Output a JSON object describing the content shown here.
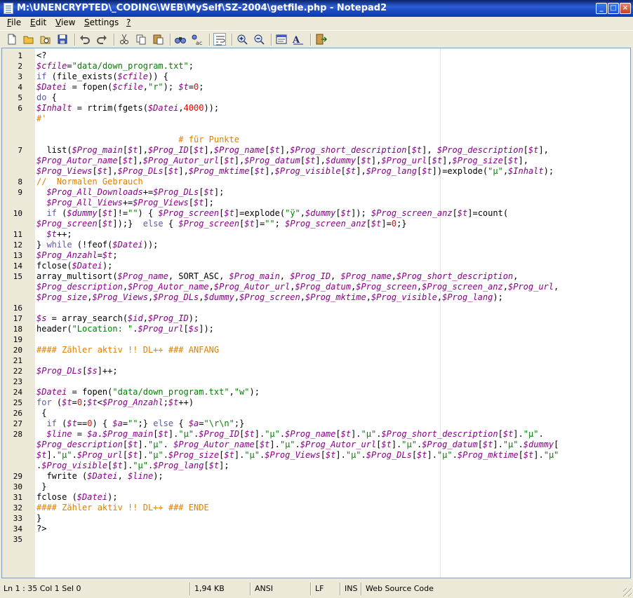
{
  "window": {
    "title": "M:\\UNENCRYPTED\\_CODING\\WEB\\MySelf\\SZ-2004\\getfile.php - Notepad2",
    "controls": [
      "minimize-icon",
      "maximize-icon",
      "close-icon"
    ]
  },
  "menu": [
    {
      "label": "File",
      "ul": "F",
      "rest": "ile"
    },
    {
      "label": "Edit",
      "ul": "E",
      "rest": "dit"
    },
    {
      "label": "View",
      "ul": "V",
      "rest": "iew"
    },
    {
      "label": "Settings",
      "ul": "S",
      "rest": "ettings"
    },
    {
      "label": "?",
      "ul": "?",
      "rest": ""
    }
  ],
  "toolbar": [
    "new-icon",
    "open-icon",
    "browse-icon",
    "save-icon",
    "undo-icon",
    "redo-icon",
    "cut-icon",
    "copy-icon",
    "paste-icon",
    "find-icon",
    "replace-icon",
    "word-wrap-icon",
    "zoom-in-icon",
    "zoom-out-icon",
    "scheme-icon",
    "font-icon",
    "exit-icon"
  ],
  "editor": {
    "lines": [
      {
        "n": "1",
        "t": "<?"
      },
      {
        "n": "2",
        "t": "$cfile=\"data/down_program.txt\";"
      },
      {
        "n": "3",
        "t": "if (file_exists($cfile)) {"
      },
      {
        "n": "4",
        "t": "$Datei = fopen($cfile,\"r\"); $t=0;"
      },
      {
        "n": "5",
        "t": "do {"
      },
      {
        "n": "6",
        "t": "$Inhalt = rtrim(fgets($Datei,4000));"
      },
      {
        "n": "",
        "t": "#'"
      },
      {
        "n": "",
        "t": ""
      },
      {
        "n": "",
        "t": "                            # für Punkte"
      },
      {
        "n": "7",
        "t": "  list($Prog_main[$t],$Prog_ID[$t],$Prog_name[$t],$Prog_short_description[$t], $Prog_description[$t],"
      },
      {
        "n": "",
        "t": "$Prog_Autor_name[$t],$Prog_Autor_url[$t],$Prog_datum[$t],$dummy[$t],$Prog_url[$t],$Prog_size[$t],"
      },
      {
        "n": "",
        "t": "$Prog_Views[$t],$Prog_DLs[$t],$Prog_mktime[$t],$Prog_visible[$t],$Prog_lang[$t])=explode(\"µ\",$Inhalt);"
      },
      {
        "n": "8",
        "t": "//  Normalen Gebrauch"
      },
      {
        "n": "9",
        "t": "  $Prog_All_Downloads+=$Prog_DLs[$t];"
      },
      {
        "n": "",
        "t": "  $Prog_All_Views+=$Prog_Views[$t];"
      },
      {
        "n": "10",
        "t": "  if ($dummy[$t]!=\"\") { $Prog_screen[$t]=explode(\"ÿ\",$dummy[$t]); $Prog_screen_anz[$t]=count("
      },
      {
        "n": "",
        "t": "$Prog_screen[$t]);}  else { $Prog_screen[$t]=\"\"; $Prog_screen_anz[$t]=0;}"
      },
      {
        "n": "11",
        "t": "  $t++;"
      },
      {
        "n": "12",
        "t": "} while (!feof($Datei));"
      },
      {
        "n": "13",
        "t": "$Prog_Anzahl=$t;"
      },
      {
        "n": "14",
        "t": "fclose($Datei);"
      },
      {
        "n": "15",
        "t": "array_multisort($Prog_name, SORT_ASC, $Prog_main, $Prog_ID, $Prog_name,$Prog_short_description,"
      },
      {
        "n": "",
        "t": "$Prog_description,$Prog_Autor_name,$Prog_Autor_url,$Prog_datum,$Prog_screen,$Prog_screen_anz,$Prog_url,"
      },
      {
        "n": "",
        "t": "$Prog_size,$Prog_Views,$Prog_DLs,$dummy,$Prog_screen,$Prog_mktime,$Prog_visible,$Prog_lang);"
      },
      {
        "n": "16",
        "t": ""
      },
      {
        "n": "17",
        "t": "$s = array_search($id,$Prog_ID);"
      },
      {
        "n": "18",
        "t": "header(\"Location: \".$Prog_url[$s]);"
      },
      {
        "n": "19",
        "t": ""
      },
      {
        "n": "20",
        "t": "#### Zähler aktiv !! DL++ ### ANFANG"
      },
      {
        "n": "21",
        "t": ""
      },
      {
        "n": "22",
        "t": "$Prog_DLs[$s]++;"
      },
      {
        "n": "23",
        "t": ""
      },
      {
        "n": "24",
        "t": "$Datei = fopen(\"data/down_program.txt\",\"w\");"
      },
      {
        "n": "25",
        "t": "for ($t=0;$t<$Prog_Anzahl;$t++)"
      },
      {
        "n": "26",
        "t": " {"
      },
      {
        "n": "27",
        "t": "  if ($t==0) { $a=\"\";} else { $a=\"\\r\\n\";}"
      },
      {
        "n": "28",
        "t": "  $line = $a.$Prog_main[$t].\"µ\".$Prog_ID[$t].\"µ\".$Prog_name[$t].\"µ\".$Prog_short_description[$t].\"µ\"."
      },
      {
        "n": "",
        "t": "$Prog_description[$t].\"µ\". $Prog_Autor_name[$t].\"µ\".$Prog_Autor_url[$t].\"µ\".$Prog_datum[$t].\"µ\".$dummy["
      },
      {
        "n": "",
        "t": "$t].\"µ\".$Prog_url[$t].\"µ\".$Prog_size[$t].\"µ\".$Prog_Views[$t].\"µ\".$Prog_DLs[$t].\"µ\".$Prog_mktime[$t].\"µ\""
      },
      {
        "n": "",
        "t": ".$Prog_visible[$t].\"µ\".$Prog_lang[$t];"
      },
      {
        "n": "29",
        "t": "  fwrite ($Datei, $line);"
      },
      {
        "n": "30",
        "t": " }"
      },
      {
        "n": "31",
        "t": "fclose ($Datei);"
      },
      {
        "n": "32",
        "t": "#### Zähler aktiv !! DL++ ### ENDE"
      },
      {
        "n": "33",
        "t": "}"
      },
      {
        "n": "34",
        "t": "?>"
      },
      {
        "n": "35",
        "t": ""
      }
    ]
  },
  "status": {
    "pos": "Ln 1 : 35   Col 1   Sel 0",
    "size": "1,94 KB",
    "encoding": "ANSI",
    "eol": "LF",
    "ins": "INS",
    "scheme": "Web Source Code"
  }
}
